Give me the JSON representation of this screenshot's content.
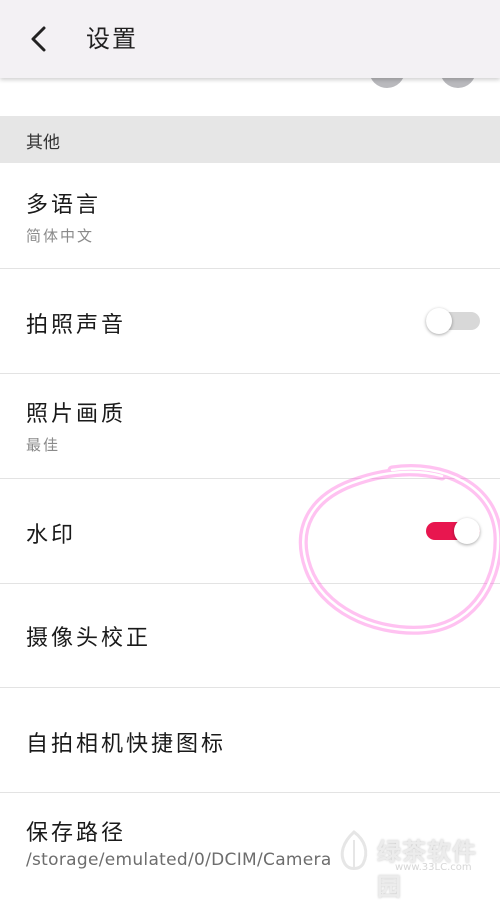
{
  "header": {
    "title": "设置",
    "back_icon": "chevron-left-icon"
  },
  "section": {
    "label": "其他"
  },
  "settings": {
    "language": {
      "label": "多语言",
      "value": "简体中文"
    },
    "shutter_sound": {
      "label": "拍照声音",
      "enabled": false
    },
    "photo_quality": {
      "label": "照片画质",
      "value": "最佳"
    },
    "watermark": {
      "label": "水印",
      "enabled": true
    },
    "camera_calibration": {
      "label": "摄像头校正"
    },
    "selfie_shortcut": {
      "label": "自拍相机快捷图标"
    },
    "save_path": {
      "label": "保存路径",
      "value": "/storage/emulated/0/DCIM/Camera"
    }
  },
  "overlay": {
    "watermark_text": "绿茶软件园",
    "watermark_url": "www.33LC.com"
  },
  "colors": {
    "accent": "#e8164f",
    "toggle_off_track": "#d8d8d8",
    "annotation": "#ff4fd8",
    "header_bg": "#f3f1f4",
    "section_bg": "#e6e6e6"
  }
}
